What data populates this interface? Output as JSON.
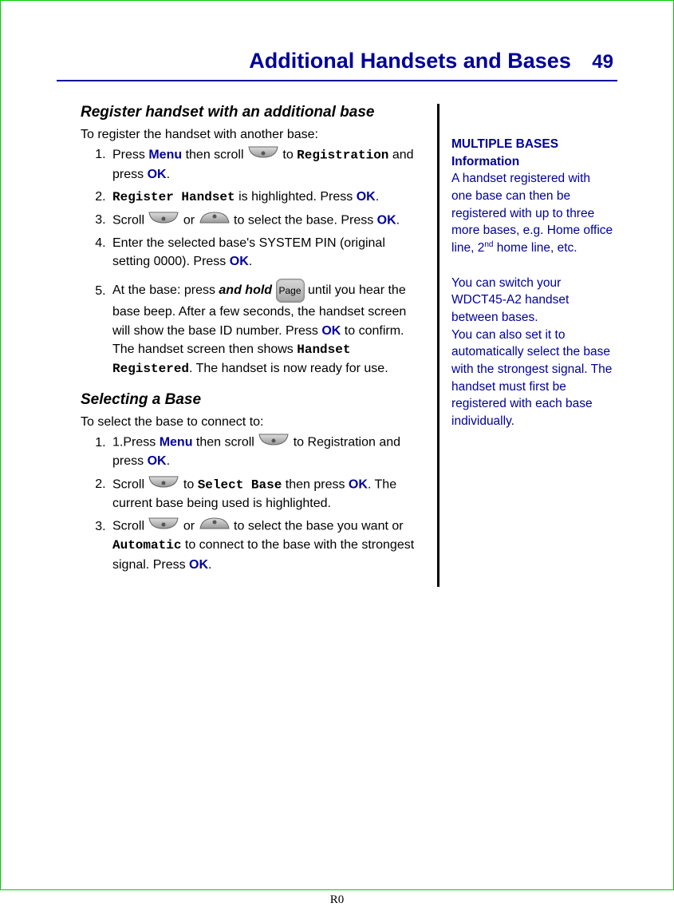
{
  "header": {
    "title": "Additional Handsets and Bases",
    "page_number": "49"
  },
  "icons": {
    "page_label": "Page"
  },
  "section1": {
    "heading": "Register handset with an additional base",
    "intro": "To register the handset with another base:",
    "step1_a": "Press ",
    "step1_menu": "Menu",
    "step1_b": " then scroll ",
    "step1_c": " to ",
    "step1_reg": "Registration",
    "step1_d": " and press ",
    "step1_ok": "OK",
    "step1_e": ".",
    "step2_reg": "Register Handset",
    "step2_a": " is highlighted.  Press ",
    "step2_ok": "OK",
    "step2_b": ".",
    "step3_a": "Scroll ",
    "step3_b": " or ",
    "step3_c": " to select the base.  Press ",
    "step3_ok": "OK",
    "step3_d": ".",
    "step4_a": "Enter the selected base's SYSTEM PIN (original setting 0000).  Press ",
    "step4_ok": "OK",
    "step4_b": ".",
    "step5_a": "At the base: press ",
    "step5_hold": "and hold",
    "step5_b": " until you hear the base beep.  After a few seconds, the handset screen will show the base ID number.  Press ",
    "step5_ok": "OK",
    "step5_c": " to confirm.  The handset screen then shows ",
    "step5_hreg": "Handset Registered",
    "step5_d": ".  The handset is now ready for use."
  },
  "section2": {
    "heading": "Selecting a Base",
    "intro": "To select the base to connect to:",
    "step1_a": "1.Press ",
    "step1_menu": "Menu",
    "step1_b": " then scroll ",
    "step1_c": " to Registration and press ",
    "step1_ok": "OK",
    "step1_d": ".",
    "step2_a": "Scroll ",
    "step2_b": " to ",
    "step2_sel": "Select Base",
    "step2_c": " then press ",
    "step2_ok": "OK",
    "step2_d": ".  The current base being used is highlighted.",
    "step3_a": "Scroll ",
    "step3_b": " or ",
    "step3_c": " to select the base you want or ",
    "step3_auto": "Automatic",
    "step3_d": " to connect to the base with the strongest signal.  Press ",
    "step3_ok": "OK",
    "step3_e": "."
  },
  "sidebar": {
    "title1": "MULTIPLE BASES",
    "title2": "Information",
    "para1_a": "A handset registered with one base can then be registered with up to three more bases, e.g. Home office line, 2",
    "para1_nd": "nd",
    "para1_b": " home line, etc.",
    "para2": "You can switch your WDCT45-A2 handset between bases.",
    "para3": "You can also set it to automatically select the base with the strongest signal.  The handset must first be registered with each base individually."
  },
  "footer": "R0"
}
